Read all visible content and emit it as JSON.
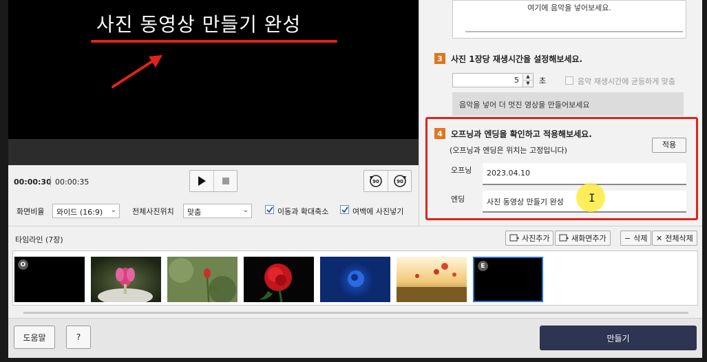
{
  "preview": {
    "overlay_title": "사진 동영상 만들기 완성",
    "accent_color": "#e32219"
  },
  "playback": {
    "current_time": "00:00:30",
    "total_time": "00:00:35",
    "play_icon": "play-icon",
    "stop_icon": "stop-icon",
    "rotate_left_label": "90",
    "rotate_right_label": "90"
  },
  "options": {
    "aspect_label": "화면비율",
    "aspect_value": "와이드 (16:9)",
    "position_label": "전체사진위치",
    "position_value": "맞춤",
    "pan_zoom_label": "이동과 확대축소",
    "pan_zoom_checked": true,
    "fill_margin_label": "여백에 사진넣기",
    "fill_margin_checked": true
  },
  "music": {
    "placeholder": "여기에 음악을 넣어보세요.",
    "tip": "음악을 넣어 더 멋진 영상을 만들어보세요"
  },
  "step3": {
    "number": "3",
    "title": "사진 1장당 재생시간을 설정해보세요.",
    "seconds_value": "5",
    "seconds_unit": "초",
    "fit_music_label": "음악 재생시간에 균등하게 맞춤",
    "fit_music_checked": false
  },
  "step4": {
    "number": "4",
    "title": "오프닝과 엔딩을 확인하고 적용해보세요.",
    "subtitle": "(오프닝과 엔딩은 위치는 고정입니다)",
    "apply_label": "적용",
    "opening_label": "오프닝",
    "opening_value": "2023.04.10",
    "ending_label": "엔딩",
    "ending_value": "사진 동영상 만들기 완성"
  },
  "timeline": {
    "title": "타임라인 (7장)",
    "add_photo_label": "사진추가",
    "add_screen_label": "새화면추가",
    "delete_label": "삭제",
    "delete_all_label": "전체삭제",
    "items": [
      {
        "badge": "O",
        "kind": "opening"
      },
      {
        "badge": "",
        "kind": "photo-pink-flower"
      },
      {
        "badge": "",
        "kind": "photo-rosebud"
      },
      {
        "badge": "",
        "kind": "photo-red-rose"
      },
      {
        "badge": "",
        "kind": "photo-blue-rose"
      },
      {
        "badge": "",
        "kind": "photo-flower-field"
      },
      {
        "badge": "E",
        "kind": "ending"
      }
    ]
  },
  "footer": {
    "help_label": "도움말",
    "question_label": "?",
    "make_label": "만들기"
  }
}
